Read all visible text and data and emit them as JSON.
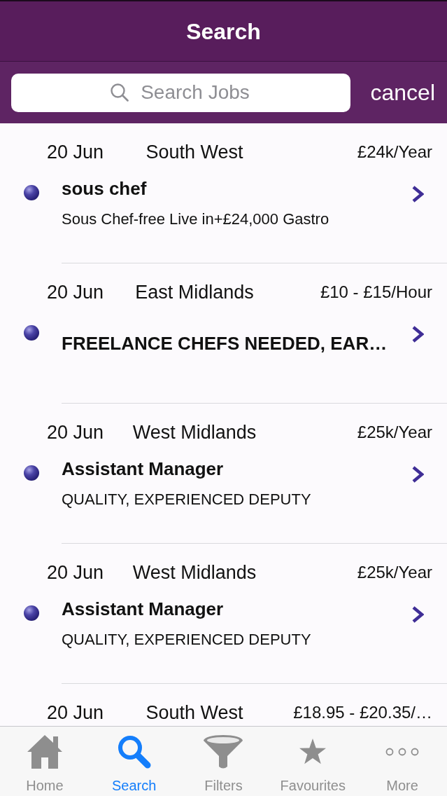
{
  "nav_bar": {
    "title": "Search"
  },
  "search": {
    "placeholder": "Search Jobs",
    "cancel": "cancel"
  },
  "jobs": [
    {
      "date": "20 Jun",
      "region": "South West",
      "salary": "£24k/Year",
      "title": "sous chef",
      "description": "Sous Chef-free Live in+£24,000 Gastro"
    },
    {
      "date": "20 Jun",
      "region": "East Midlands",
      "salary": "£10 - £15/Hour",
      "title": "FREELANCE CHEFS NEEDED, EAR…"
    },
    {
      "date": "20 Jun",
      "region": "West Midlands",
      "salary": "£25k/Year",
      "title": "Assistant Manager",
      "description": "QUALITY, EXPERIENCED DEPUTY"
    },
    {
      "date": "20 Jun",
      "region": "West Midlands",
      "salary": "£25k/Year",
      "title": "Assistant Manager",
      "description": "QUALITY, EXPERIENCED DEPUTY"
    },
    {
      "date": "20 Jun",
      "region": "South West",
      "salary": "£18.95 - £20.35/…"
    }
  ],
  "tab_bar": [
    {
      "label": "Home",
      "selected": false
    },
    {
      "label": "Search",
      "selected": true
    },
    {
      "label": "Filters",
      "selected": false
    },
    {
      "label": "Favourites",
      "selected": false
    },
    {
      "label": "More",
      "selected": false
    }
  ]
}
